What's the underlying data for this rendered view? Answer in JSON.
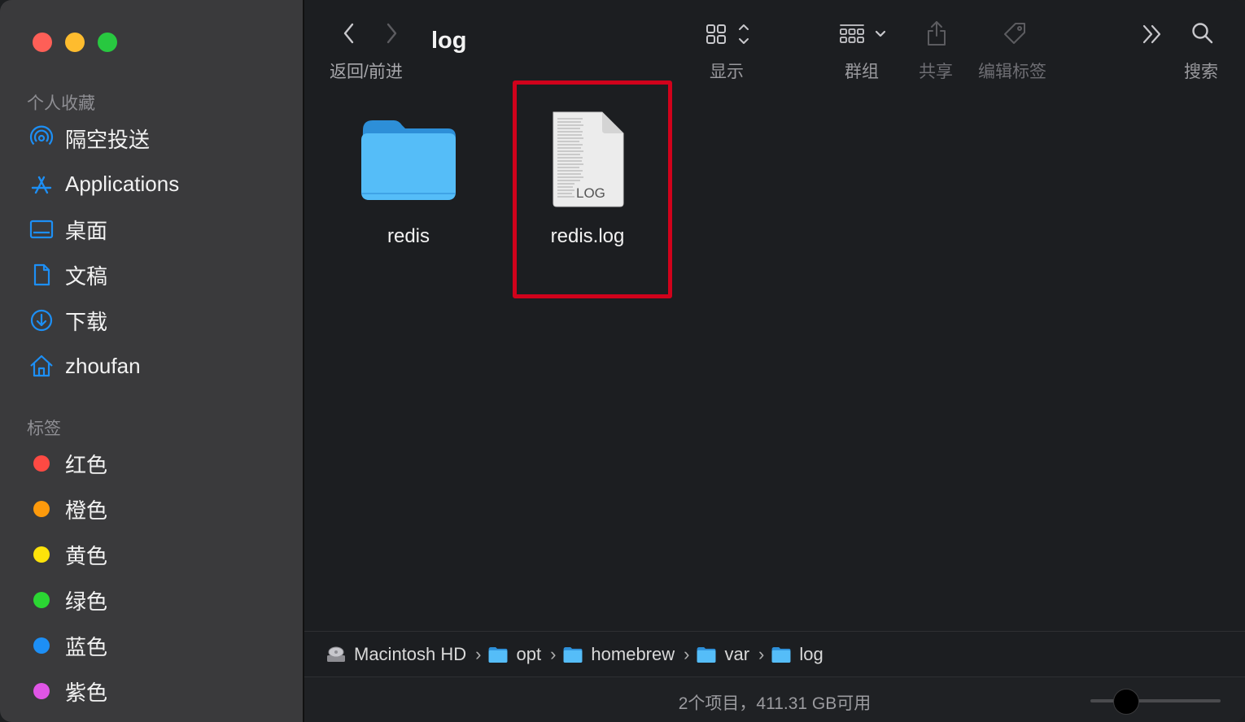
{
  "sidebar": {
    "favorites_header": "个人收藏",
    "favorites": [
      {
        "label": "隔空投送",
        "icon": "airdrop-icon"
      },
      {
        "label": "Applications",
        "icon": "applications-icon"
      },
      {
        "label": "桌面",
        "icon": "desktop-icon"
      },
      {
        "label": "文稿",
        "icon": "documents-icon"
      },
      {
        "label": "下载",
        "icon": "downloads-icon"
      },
      {
        "label": "zhoufan",
        "icon": "home-icon"
      }
    ],
    "tags_header": "标签",
    "tags": [
      {
        "label": "红色",
        "color": "#fe4a43"
      },
      {
        "label": "橙色",
        "color": "#fd9a0c"
      },
      {
        "label": "黄色",
        "color": "#fde30a"
      },
      {
        "label": "绿色",
        "color": "#2bd633"
      },
      {
        "label": "蓝色",
        "color": "#1d8ff5"
      },
      {
        "label": "紫色",
        "color": "#e055e6"
      }
    ]
  },
  "toolbar": {
    "title": "log",
    "back_forward_label": "返回/前进",
    "view_label": "显示",
    "group_label": "群组",
    "share_label": "共享",
    "tags_label": "编辑标签",
    "search_label": "搜索"
  },
  "files": [
    {
      "name": "redis",
      "kind": "folder-icon"
    },
    {
      "name": "redis.log",
      "kind": "log-file-icon",
      "badge": "LOG"
    }
  ],
  "pathbar": {
    "segments": [
      "Macintosh HD",
      "opt",
      "homebrew",
      "var",
      "log"
    ]
  },
  "status": {
    "text": "2个项目，411.31 GB可用",
    "icon_size_slider": 0.26
  },
  "colors": {
    "accent": "#1d8ff5",
    "highlight": "#d0021b",
    "folder": "#55bdf8"
  }
}
